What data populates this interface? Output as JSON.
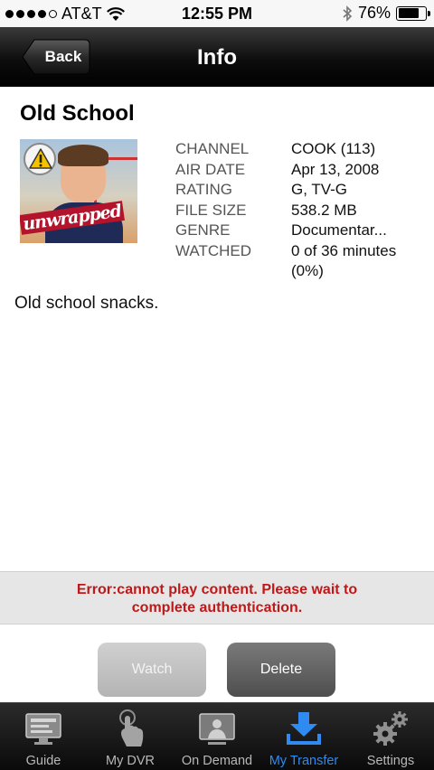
{
  "status_bar": {
    "carrier": "AT&T",
    "time": "12:55 PM",
    "battery": "76%",
    "battery_level": 0.76,
    "signal_dots_filled": 4
  },
  "nav": {
    "back_label": "Back",
    "title": "Info"
  },
  "show": {
    "title": "Old School",
    "thumbnail_wordmark": "unwrapped",
    "details": [
      {
        "key": "CHANNEL",
        "value": "COOK (113)"
      },
      {
        "key": "AIR DATE",
        "value": "Apr 13, 2008"
      },
      {
        "key": "RATING",
        "value": "G, TV-G"
      },
      {
        "key": "FILE SIZE",
        "value": "538.2 MB"
      },
      {
        "key": "GENRE",
        "value": "Documentar..."
      },
      {
        "key": "WATCHED",
        "value": "0 of 36 minutes (0%)"
      }
    ],
    "description": "Old school snacks."
  },
  "error": {
    "line1": "Error:cannot play content. Please wait to",
    "line2": "complete authentication."
  },
  "actions": {
    "watch_label": "Watch",
    "delete_label": "Delete"
  },
  "tabs": [
    {
      "label": "Guide",
      "icon": "guide-icon",
      "active": false
    },
    {
      "label": "My DVR",
      "icon": "touch-icon",
      "active": false
    },
    {
      "label": "On Demand",
      "icon": "on-demand-icon",
      "active": false
    },
    {
      "label": "My Transfer",
      "icon": "download-icon",
      "active": true
    },
    {
      "label": "Settings",
      "icon": "gears-icon",
      "active": false
    }
  ],
  "colors": {
    "error_text": "#c01818",
    "active_tab": "#2f8bf2",
    "nav_bg": "#000000"
  }
}
